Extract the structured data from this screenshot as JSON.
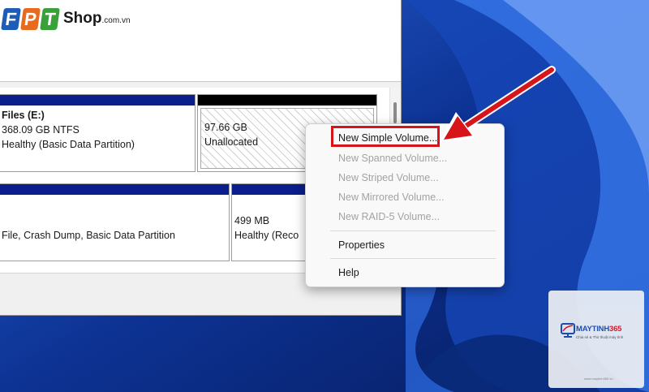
{
  "brand_logo": {
    "letters": [
      "F",
      "P",
      "T"
    ],
    "name": "Shop",
    "suffix": ".com.vn",
    "colors": {
      "f": "#1f5cb5",
      "p": "#e86a1d",
      "t": "#3aa13a"
    }
  },
  "disk_partitions": {
    "row1": [
      {
        "title": "Files  (E:)",
        "size": "368.09 GB NTFS",
        "status": "Healthy (Basic Data Partition)",
        "bar_color": "#0a1e8c"
      },
      {
        "title": "",
        "size": "97.66 GB",
        "status": "Unallocated",
        "bar_color": "#000000"
      }
    ],
    "row2": [
      {
        "title": "",
        "size": "",
        "status": "File, Crash Dump, Basic Data Partition",
        "bar_color": "#0a1e8c"
      },
      {
        "title": "",
        "size": "499 MB",
        "status": "Healthy (Reco",
        "bar_color": "#0a1e8c"
      }
    ]
  },
  "context_menu": {
    "items": [
      {
        "label": "New Simple Volume...",
        "enabled": true
      },
      {
        "label": "New Spanned Volume...",
        "enabled": false
      },
      {
        "label": "New Striped Volume...",
        "enabled": false
      },
      {
        "label": "New Mirrored Volume...",
        "enabled": false
      },
      {
        "label": "New RAID-5 Volume...",
        "enabled": false
      },
      {
        "label": "Properties",
        "enabled": true
      },
      {
        "label": "Help",
        "enabled": true
      }
    ]
  },
  "annotation": {
    "highlight_color": "#d8141b",
    "arrow_icon": "red-arrow-icon"
  },
  "watermark": {
    "brand_main": "MAYTINH",
    "brand_num": "365",
    "tagline": "Chia sẻ & Thủ thuật máy tính",
    "url": "www.maytinh365.vn"
  },
  "colors": {
    "partition_bar": "#0a1e8c",
    "unallocated_bar": "#000000",
    "wallpaper": "#0b2e86"
  }
}
